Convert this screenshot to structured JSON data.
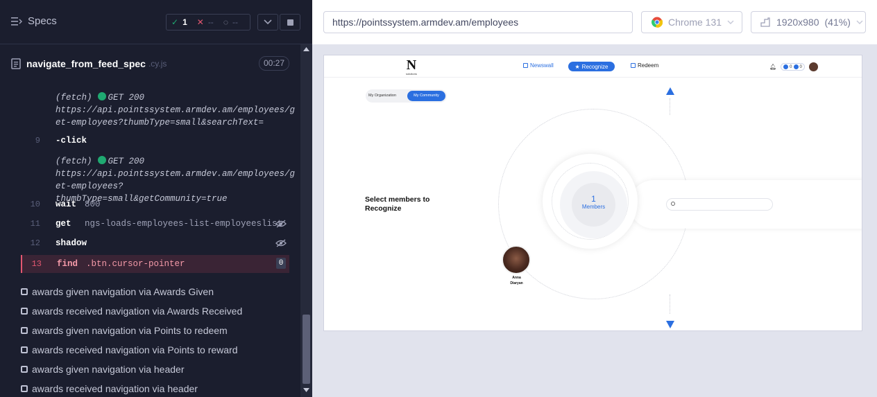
{
  "runner": {
    "specs_label": "Specs",
    "passed": "1",
    "failed": "--",
    "pending": "--",
    "spec_name": "navigate_from_feed_spec",
    "spec_ext": ".cy.js",
    "duration": "00:27"
  },
  "command_log": {
    "fetch1": {
      "prefix": "(fetch)",
      "text": "GET 200",
      "url1": "https://api.pointssystem.armdev.am/employees/g",
      "url2": "et-employees?thumbType=small&searchText="
    },
    "cmd9": {
      "num": "9",
      "name": "-click"
    },
    "fetch2": {
      "prefix": "(fetch)",
      "text": "GET 200",
      "url1": "https://api.pointssystem.armdev.am/employees/g",
      "url2": "et-employees?thumbType=small&getCommunity=true"
    },
    "cmd10": {
      "num": "10",
      "name": "wait",
      "msg": "800"
    },
    "cmd11": {
      "num": "11",
      "name": "get",
      "msg": "ngs-loads-employees-list-employeeslist"
    },
    "cmd12": {
      "num": "12",
      "name": "shadow"
    },
    "cmd13": {
      "num": "13",
      "name": "find",
      "msg": ".btn.cursor-pointer",
      "badge": "0"
    }
  },
  "tests": [
    "awards given navigation via Awards Given",
    "awards received navigation via Awards Received",
    "awards given navigation via Points to redeem",
    "awards received navigation via Points to reward",
    "awards given navigation via header",
    "awards received navigation via header"
  ],
  "browser_bar": {
    "url": "https://pointssystem.armdev.am/employees",
    "browser": "Chrome 131",
    "viewport": "1920x980",
    "scale": "(41%)"
  },
  "app": {
    "logo_letter": "N",
    "logo_sub": "solutions",
    "nav": {
      "newswall": "Newswall",
      "recognize": "Recognize",
      "redeem": "Redeem"
    },
    "points1": "0",
    "points2": "0",
    "toggle": {
      "org": "My Organization",
      "community": "My Community"
    },
    "select_text": "Select members to Recognize",
    "members_count": "1",
    "members_label": "Members",
    "person_first": "Anna",
    "person_last": "Diaryan"
  },
  "colors": {
    "accent": "#2b6fe0",
    "pass": "#1fa971",
    "fail": "#e45770"
  }
}
